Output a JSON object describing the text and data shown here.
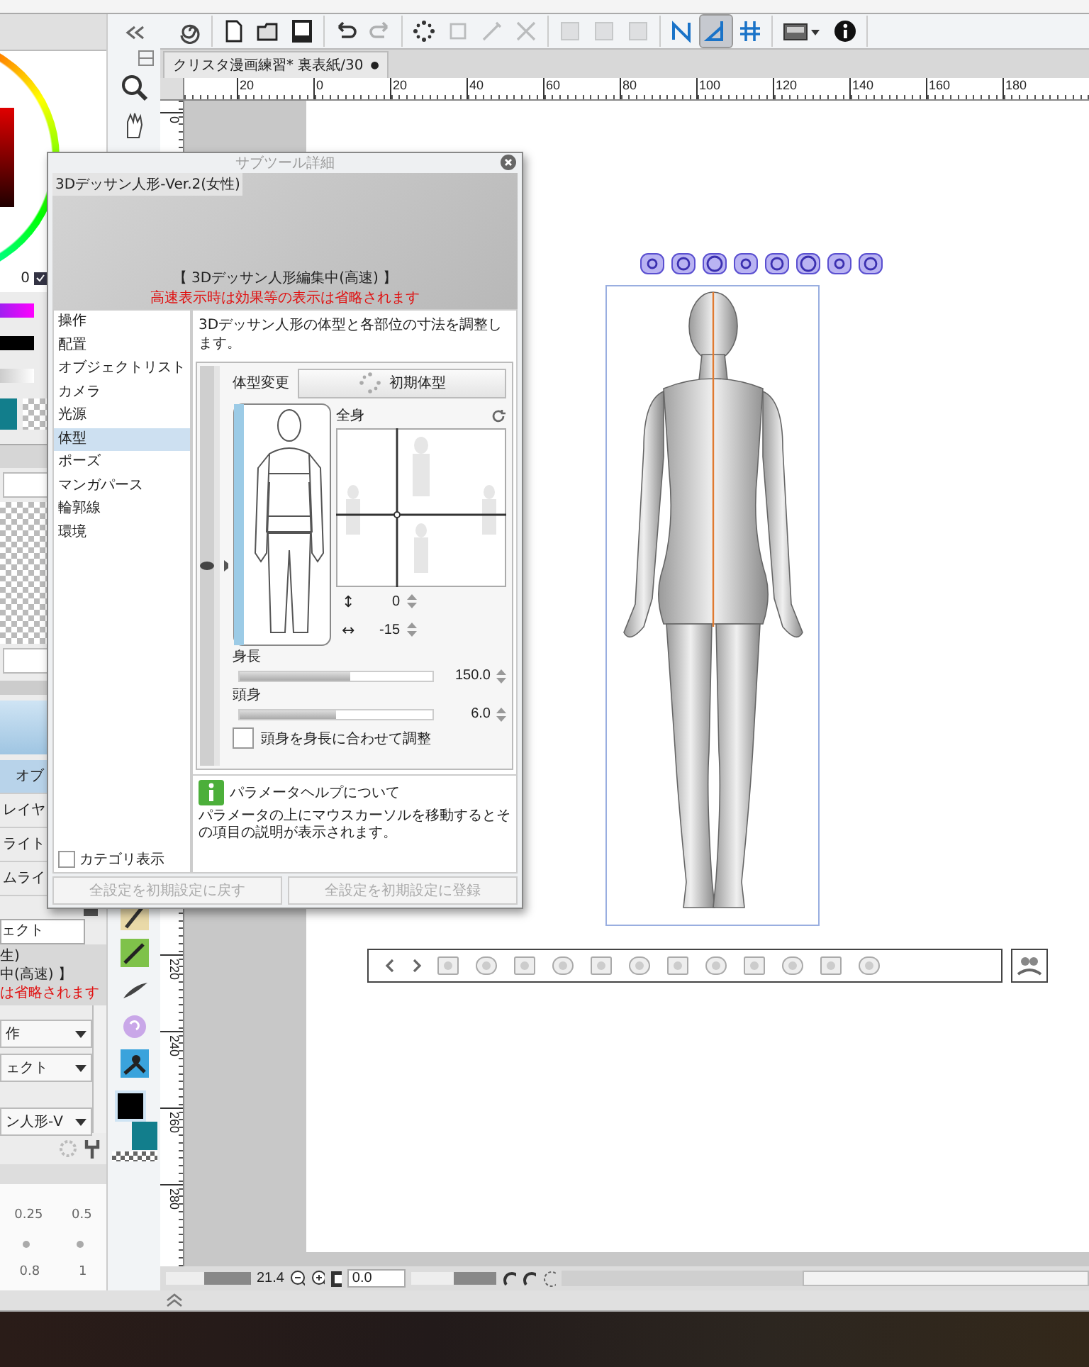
{
  "left_panel": {
    "color_value": "0",
    "rows": [
      {
        "kind": "header",
        "text": "オブ"
      },
      {
        "kind": "item",
        "text": "レイヤ"
      },
      {
        "kind": "item",
        "text": "ライト"
      },
      {
        "kind": "item",
        "text": "ムライ"
      }
    ],
    "object_tab": "ェクト",
    "info_lines": [
      {
        "kind": "plain",
        "text": "生)"
      },
      {
        "kind": "plain",
        "text": "中(高速) 】"
      },
      {
        "kind": "warning",
        "text": "は省略されます"
      }
    ],
    "dropdowns": [
      "作",
      "ェクト",
      "ン人形-V"
    ],
    "grid_values": [
      [
        "0.25",
        "0.5"
      ],
      [
        "0.8",
        "1"
      ]
    ]
  },
  "toolbar": {
    "groups": [
      [
        {
          "kind": "spiral",
          "disabled": false,
          "selected": false
        }
      ],
      [
        {
          "kind": "new",
          "disabled": false,
          "selected": false
        },
        {
          "kind": "open",
          "disabled": false,
          "selected": false
        },
        {
          "kind": "save",
          "disabled": false,
          "selected": false
        }
      ],
      [
        {
          "kind": "undo",
          "disabled": false,
          "selected": false
        },
        {
          "kind": "redo",
          "disabled": true,
          "selected": false
        }
      ],
      [
        {
          "kind": "sparkle",
          "disabled": false,
          "selected": false
        },
        {
          "kind": "frame",
          "disabled": true,
          "selected": false
        },
        {
          "kind": "pen",
          "disabled": true,
          "selected": false
        },
        {
          "kind": "cross",
          "disabled": true,
          "selected": false
        }
      ],
      [
        {
          "kind": "box",
          "disabled": true,
          "selected": false
        },
        {
          "kind": "box",
          "disabled": true,
          "selected": false
        },
        {
          "kind": "box",
          "disabled": true,
          "selected": false
        }
      ],
      [
        {
          "kind": "ruler-n",
          "disabled": false,
          "selected": false
        },
        {
          "kind": "ruler-l",
          "disabled": false,
          "selected": true
        },
        {
          "kind": "ruler-grid",
          "disabled": false,
          "selected": false
        }
      ],
      [
        {
          "kind": "layer-menu",
          "disabled": false,
          "selected": false
        },
        {
          "kind": "info",
          "disabled": false,
          "selected": false
        }
      ]
    ]
  },
  "document_tab": {
    "title": "クリスタ漫画練習* 裏表紙/30",
    "close": "●"
  },
  "ruler": {
    "top_labels": [
      "20",
      "0",
      "20",
      "40",
      "60",
      "80",
      "100",
      "120",
      "140",
      "160",
      "180"
    ],
    "side_labels": [
      "0",
      "220",
      "240",
      "260",
      "280"
    ]
  },
  "dialog": {
    "title": "サブツール詳細",
    "preview": {
      "name": "3Dデッサン人形-Ver.2(女性)",
      "status": "【 3Dデッサン人形編集中(高速) 】",
      "warning": "高速表示時は効果等の表示は省略されます"
    },
    "categories": [
      {
        "label": "操作",
        "selected": false
      },
      {
        "label": "配置",
        "selected": false
      },
      {
        "label": "オブジェクトリスト",
        "selected": false
      },
      {
        "label": "カメラ",
        "selected": false
      },
      {
        "label": "光源",
        "selected": false
      },
      {
        "label": "体型",
        "selected": true
      },
      {
        "label": "ポーズ",
        "selected": false
      },
      {
        "label": "マンガパース",
        "selected": false
      },
      {
        "label": "輪郭線",
        "selected": false
      },
      {
        "label": "環境",
        "selected": false
      }
    ],
    "show_categories": {
      "label": "カテゴリ表示",
      "checked": false
    },
    "description": "3Dデッサン人形の体型と各部位の寸法を調整します。",
    "body_shape": {
      "label": "体型変更",
      "reset_button": "初期体型",
      "part_label": "全身",
      "vertical": {
        "glyph": "↕",
        "value": "0"
      },
      "horizontal": {
        "glyph": "↔",
        "value": "-15"
      },
      "sliders": [
        {
          "label": "身長",
          "value": "150.0",
          "level": 0.57
        },
        {
          "label": "頭身",
          "value": "6.0",
          "level": 0.5
        }
      ],
      "link_checkbox": {
        "label": "頭身を身長に合わせて調整",
        "checked": false
      }
    },
    "help": {
      "title": "パラメータヘルプについて",
      "text": "パラメータの上にマウスカーソルを移動するとその項目の説明が表示されます。"
    },
    "footer_buttons": [
      {
        "label": "全設定を初期設定に戻す",
        "disabled": true
      },
      {
        "label": "全設定を初期設定に登録",
        "disabled": true
      }
    ]
  },
  "status_bar": {
    "zoom_slider": {
      "level": 0.55
    },
    "zoom": "21.4",
    "angle": "0.0",
    "angle_slider": {
      "level": 0.5
    }
  }
}
